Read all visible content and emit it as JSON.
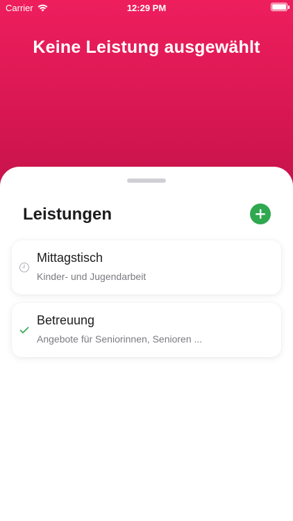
{
  "status_bar": {
    "carrier": "Carrier",
    "time": "12:29 PM"
  },
  "header": {
    "title": "Keine Leistung ausgewählt"
  },
  "sheet": {
    "title": "Leistungen",
    "items": [
      {
        "title": "Mittagstisch",
        "subtitle": "Kinder- und Jugendarbeit",
        "icon": "clock-icon"
      },
      {
        "title": "Betreuung",
        "subtitle": "Angebote für Seniorinnen, Senioren ...",
        "icon": "checkmark-icon"
      }
    ]
  },
  "colors": {
    "header_top": "#ee1e5d",
    "header_bottom": "#c21249",
    "add_button": "#2fa84f",
    "check": "#2fa84f"
  }
}
